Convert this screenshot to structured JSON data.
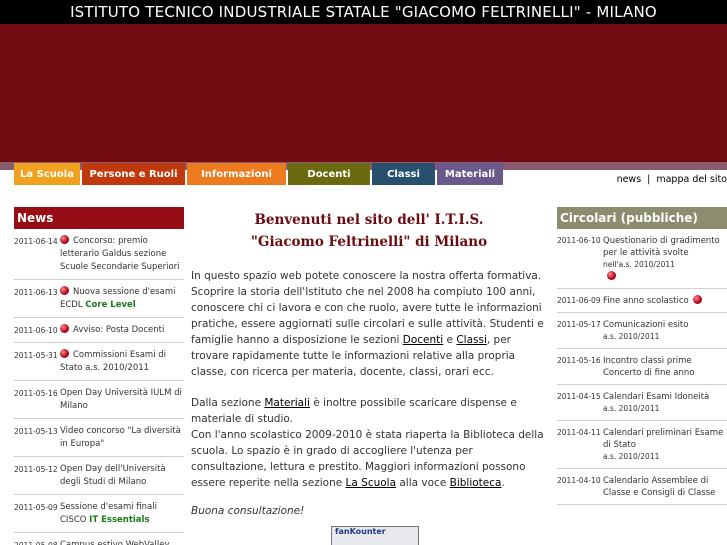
{
  "header": {
    "title": "ISTITUTO TECNICO INDUSTRIALE STATALE \"GIACOMO FELTRINELLI\" - MILANO"
  },
  "colors": {
    "banner": "#720b12",
    "news_head": "#960d16",
    "circolari_head": "#8c8c6e"
  },
  "menu": [
    {
      "label": "La Scuola",
      "color": "#f0a11e",
      "text_color": "#fff"
    },
    {
      "label": "Persone e Ruoli",
      "color": "#c0390c",
      "text_color": "#fff"
    },
    {
      "label": "Informazioni",
      "color": "#ee7a1e",
      "text_color": "#fff"
    },
    {
      "label": "Docenti",
      "color": "#6b6a10",
      "text_color": "#fff"
    },
    {
      "label": "Classi",
      "color": "#27506e",
      "text_color": "#fff"
    },
    {
      "label": "Materiali",
      "color": "#6a5a8c",
      "text_color": "#fff"
    }
  ],
  "toplinks": {
    "news": "news",
    "sep": "|",
    "mappa": "mappa del sito"
  },
  "news": {
    "heading": "News",
    "items": [
      {
        "date": "2011-06-14",
        "bullet": true,
        "text": "Concorso: premio letterario Galdus sezione Scuole Secondarie Superiori",
        "extra": ""
      },
      {
        "date": "2011-06-13",
        "bullet": true,
        "text": "Nuova sessione d'esami ECDL",
        "extra": "Core Level"
      },
      {
        "date": "2011-06-10",
        "bullet": true,
        "text": "Avviso: Posta Docenti",
        "extra": ""
      },
      {
        "date": "2011-05-31",
        "bullet": true,
        "text": "Commissioni Esami di Stato a.s. 2010/2011",
        "extra": ""
      },
      {
        "date": "2011-05-16",
        "bullet": false,
        "text": "Open Day Università IULM di Milano",
        "extra": ""
      },
      {
        "date": "2011-05-13",
        "bullet": false,
        "text": "Video concorso \"La diversità in Europa\"",
        "extra": ""
      },
      {
        "date": "2011-05-12",
        "bullet": false,
        "text": "Open Day dell'Università degli Studi di Milano",
        "extra": ""
      },
      {
        "date": "2011-05-09",
        "bullet": false,
        "text": "Sessione d'esami finali CISCO",
        "extra": "IT Essentials"
      },
      {
        "date": "2011-05-08",
        "bullet": false,
        "text": "Campus estivo WebValley",
        "extra": ""
      }
    ]
  },
  "center": {
    "welcome_line1": "Benvenuti nel sito dell' I.T.I.S.",
    "welcome_line2": "\"Giacomo Feltrinelli\" di Milano",
    "p1_a": "In questo spazio web potete conoscere la nostra offerta formativa. Scoprire la storia dell'Istituto che nel 2008 ha compiuto 100 anni, conoscere chi ci lavora e con che ruolo, avere tutte le informazioni pratiche, essere aggiornati sulle circolari e sulle attività. Studenti e famiglie hanno a disposizione le sezioni ",
    "p1_link1": "Docenti",
    "p1_mid": " e ",
    "p1_link2": "Classi",
    "p1_b": ", per trovare rapidamente tutte le informazioni relative alla propria classe, con ricerca per materia, docente, classi, orari ecc.",
    "p2_a": "Dalla sezione ",
    "p2_link1": "Materiali",
    "p2_b": " è inoltre possibile scaricare dispense e materiale di studio.",
    "p2_c": "Con l'anno scolastico 2009-2010 è stata riaperta la Biblioteca della scuola. Lo spazio è in grado di accogliere l'utenza per consultazione, lettura e prestito. Maggiori informazioni possono essere reperite nella sezione ",
    "p2_link2": "La Scuola",
    "p2_d": " alla voce ",
    "p2_link3": "Biblioteca",
    "p2_e": ".",
    "sign": "Buona consultazione!",
    "counter": "fanKounter"
  },
  "circolari": {
    "heading": "Circolari (pubbliche)",
    "items": [
      {
        "date": "2011-06-10",
        "text": "Questionario di gradimento per le attività svolte",
        "sub": "nell'a.s. 2010/2011",
        "bullet": true
      },
      {
        "date": "2011-06-09",
        "text": "Fine anno scolastico",
        "sub": "",
        "bullet": true
      },
      {
        "date": "2011-05-17",
        "text": "Comunicazioni esito",
        "sub": "a.s. 2010/2011",
        "bullet": false
      },
      {
        "date": "2011-05-16",
        "text": "Incontro classi prime Concerto di fine anno",
        "sub": "",
        "bullet": false
      },
      {
        "date": "2011-04-15",
        "text": "Calendari Esami Idoneità",
        "sub": "a.s. 2010/2011",
        "bullet": false
      },
      {
        "date": "2011-04-11",
        "text": "Calendari preliminari Esame di Stato",
        "sub": "a.s. 2010/2011",
        "bullet": false
      },
      {
        "date": "2011-04-10",
        "text": "Calendario Assemblee di Classe e Consigli di Classe",
        "sub": "",
        "bullet": false
      }
    ]
  }
}
